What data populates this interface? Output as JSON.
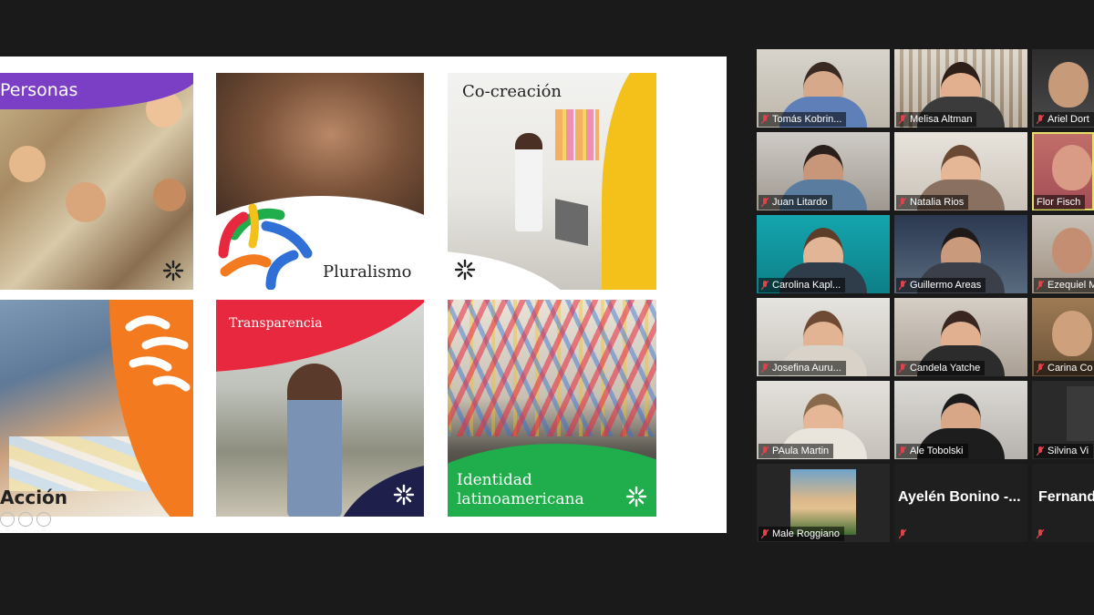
{
  "slide": {
    "tiles": {
      "personas": "Personas",
      "pluralismo": "Pluralismo",
      "cocreacion": "Co-creación",
      "accion": "Acción",
      "transparencia": "Transparencia",
      "identidad_line1": "Identidad",
      "identidad_line2": "latinoamericana"
    }
  },
  "participants": [
    {
      "name": "Tomás Kobrin...",
      "muted": true
    },
    {
      "name": "Melisa Altman",
      "muted": true
    },
    {
      "name": "Ariel Dort",
      "muted": true
    },
    {
      "name": "Juan Litardo",
      "muted": true
    },
    {
      "name": "Natalia Rios",
      "muted": true
    },
    {
      "name": "Flor Fisch",
      "muted": false,
      "active_speaker": true
    },
    {
      "name": "Carolina Kapl...",
      "muted": true
    },
    {
      "name": "Guillermo Areas",
      "muted": true
    },
    {
      "name": "Ezequiel M",
      "muted": true
    },
    {
      "name": "Josefina Auru...",
      "muted": true
    },
    {
      "name": "Candela Yatche",
      "muted": true
    },
    {
      "name": "Carina Co",
      "muted": true
    },
    {
      "name": "PAula Martin",
      "muted": true
    },
    {
      "name": "Ale Tobolski",
      "muted": true
    },
    {
      "name": "Silvina Vi",
      "muted": true
    },
    {
      "name": "Male Roggiano",
      "muted": true
    },
    {
      "name": "Ayelén Bonino -...",
      "muted": true,
      "video_off": true
    },
    {
      "name": "Fernand",
      "muted": true,
      "video_off": true
    }
  ],
  "colors": {
    "purple": "#7b3fc6",
    "orange": "#f47a1f",
    "red": "#e8283e",
    "green": "#1fae4b",
    "yellow": "#f4c01a",
    "navy": "#1e1f4a",
    "muted_icon": "#e0414a",
    "active_border": "#e6e06a"
  },
  "icons": [
    "asterisk-burst-icon",
    "mic-muted-icon",
    "zoom-in-icon",
    "zoom-out-icon"
  ]
}
